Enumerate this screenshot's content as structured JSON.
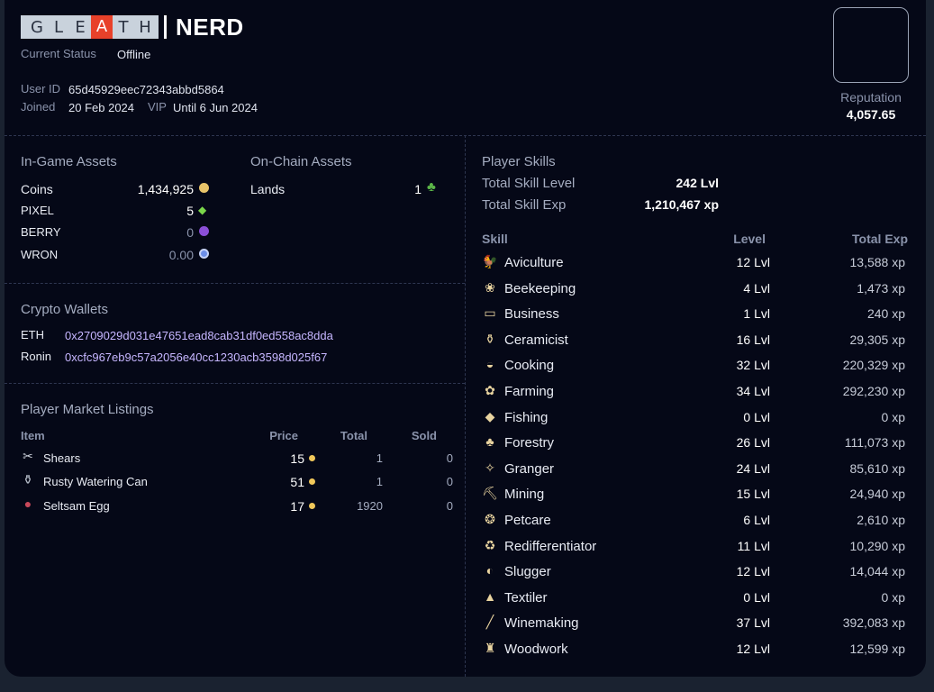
{
  "header": {
    "logo_letters": [
      "G",
      "L",
      "E",
      "A",
      "T",
      "H"
    ],
    "username": "NERD",
    "current_status_label": "Current Status",
    "current_status_value": "Offline",
    "user_id_label": "User ID",
    "user_id_value": "65d45929eec72343abbd5864",
    "joined_label": "Joined",
    "joined_value": "20 Feb 2024",
    "vip_label": "VIP",
    "vip_value": "Until 6 Jun 2024",
    "reputation_label": "Reputation",
    "reputation_value": "4,057.65"
  },
  "in_game_assets": {
    "title": "In-Game Assets",
    "items": [
      {
        "label": "Coins",
        "value": "1,434,925",
        "icon": "coin-icon",
        "color": "#e8c46a"
      },
      {
        "label": "PIXEL",
        "value": "5",
        "icon": "gem-icon",
        "color": "#7ad64a"
      },
      {
        "label": "BERRY",
        "value": "0",
        "icon": "berry-icon",
        "color": "#8b4fd8"
      },
      {
        "label": "WRON",
        "value": "0.00",
        "icon": "ronin-icon",
        "color": "#6c8ee8"
      }
    ]
  },
  "on_chain_assets": {
    "title": "On-Chain Assets",
    "items": [
      {
        "label": "Lands",
        "value": "1",
        "icon": "tree-icon",
        "color": "#5bb548"
      }
    ]
  },
  "crypto_wallets": {
    "title": "Crypto Wallets",
    "items": [
      {
        "label": "ETH",
        "value": "0x2709029d031e47651ead8cab31df0ed558ac8dda"
      },
      {
        "label": "Ronin",
        "value": "0xcfc967eb9c57a2056e40cc1230acb3598d025f67"
      }
    ]
  },
  "market_listings": {
    "title": "Player Market Listings",
    "columns": {
      "item": "Item",
      "price": "Price",
      "total": "Total",
      "sold": "Sold"
    },
    "rows": [
      {
        "icon": "shears-icon",
        "glyph": "✂",
        "name": "Shears",
        "price": "15",
        "total": "1",
        "sold": "0"
      },
      {
        "icon": "watering-can-icon",
        "glyph": "⚱",
        "name": "Rusty Watering Can",
        "price": "51",
        "total": "1",
        "sold": "0"
      },
      {
        "icon": "egg-icon",
        "glyph": "●",
        "name": "Seltsam Egg",
        "price": "17",
        "total": "1920",
        "sold": "0"
      }
    ]
  },
  "player_skills": {
    "title": "Player Skills",
    "total_level_label": "Total Skill Level",
    "total_level_value": "242 Lvl",
    "total_exp_label": "Total Skill Exp",
    "total_exp_value": "1,210,467 xp",
    "columns": {
      "skill": "Skill",
      "level": "Level",
      "exp": "Total Exp"
    },
    "skills": [
      {
        "icon": "aviculture-icon",
        "glyph": "🐓",
        "name": "Aviculture",
        "level": "12 Lvl",
        "exp": "13,588 xp"
      },
      {
        "icon": "beekeeping-icon",
        "glyph": "❀",
        "name": "Beekeeping",
        "level": "4 Lvl",
        "exp": "1,473 xp"
      },
      {
        "icon": "business-icon",
        "glyph": "▭",
        "name": "Business",
        "level": "1 Lvl",
        "exp": "240 xp"
      },
      {
        "icon": "ceramicist-icon",
        "glyph": "⚱",
        "name": "Ceramicist",
        "level": "16 Lvl",
        "exp": "29,305 xp"
      },
      {
        "icon": "cooking-icon",
        "glyph": "◒",
        "name": "Cooking",
        "level": "32 Lvl",
        "exp": "220,329 xp"
      },
      {
        "icon": "farming-icon",
        "glyph": "✿",
        "name": "Farming",
        "level": "34 Lvl",
        "exp": "292,230 xp"
      },
      {
        "icon": "fishing-icon",
        "glyph": "◆",
        "name": "Fishing",
        "level": "0 Lvl",
        "exp": "0 xp"
      },
      {
        "icon": "forestry-icon",
        "glyph": "♣",
        "name": "Forestry",
        "level": "26 Lvl",
        "exp": "111,073 xp"
      },
      {
        "icon": "granger-icon",
        "glyph": "✧",
        "name": "Granger",
        "level": "24 Lvl",
        "exp": "85,610 xp"
      },
      {
        "icon": "mining-icon",
        "glyph": "⛏",
        "name": "Mining",
        "level": "15 Lvl",
        "exp": "24,940 xp"
      },
      {
        "icon": "petcare-icon",
        "glyph": "❂",
        "name": "Petcare",
        "level": "6 Lvl",
        "exp": "2,610 xp"
      },
      {
        "icon": "redifferentiator-icon",
        "glyph": "♻",
        "name": "Redifferentiator",
        "level": "11 Lvl",
        "exp": "10,290 xp"
      },
      {
        "icon": "slugger-icon",
        "glyph": "◐",
        "name": "Slugger",
        "level": "12 Lvl",
        "exp": "14,044 xp"
      },
      {
        "icon": "textiler-icon",
        "glyph": "▲",
        "name": "Textiler",
        "level": "0 Lvl",
        "exp": "0 xp"
      },
      {
        "icon": "winemaking-icon",
        "glyph": "╱",
        "name": "Winemaking",
        "level": "37 Lvl",
        "exp": "392,083 xp"
      },
      {
        "icon": "woodwork-icon",
        "glyph": "♜",
        "name": "Woodwork",
        "level": "12 Lvl",
        "exp": "12,599 xp"
      }
    ]
  }
}
